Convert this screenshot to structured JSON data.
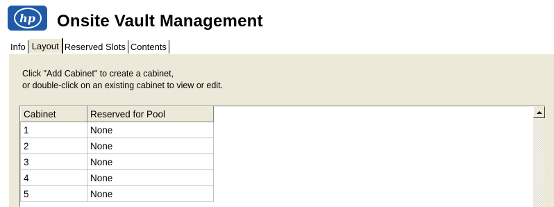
{
  "header": {
    "logo_text": "hp",
    "title": "Onsite Vault Management"
  },
  "tabs": [
    {
      "label": "Info",
      "active": false
    },
    {
      "label": "Layout",
      "active": true
    },
    {
      "label": "Reserved Slots",
      "active": false
    },
    {
      "label": "Contents",
      "active": false
    }
  ],
  "instructions": {
    "line1": "Click \"Add Cabinet\" to create a cabinet,",
    "line2": "or double-click on an existing cabinet to view or edit."
  },
  "grid": {
    "columns": [
      "Cabinet",
      "Reserved for Pool"
    ],
    "rows": [
      [
        "1",
        "None"
      ],
      [
        "2",
        "None"
      ],
      [
        "3",
        "None"
      ],
      [
        "4",
        "None"
      ],
      [
        "5",
        "None"
      ]
    ]
  },
  "icons": {
    "logo": "hp-logo-icon",
    "scroll_up": "scroll-up-arrow-icon"
  },
  "colors": {
    "logo_blue": "#1f5aa6",
    "panel_bg": "#ece9d8"
  }
}
